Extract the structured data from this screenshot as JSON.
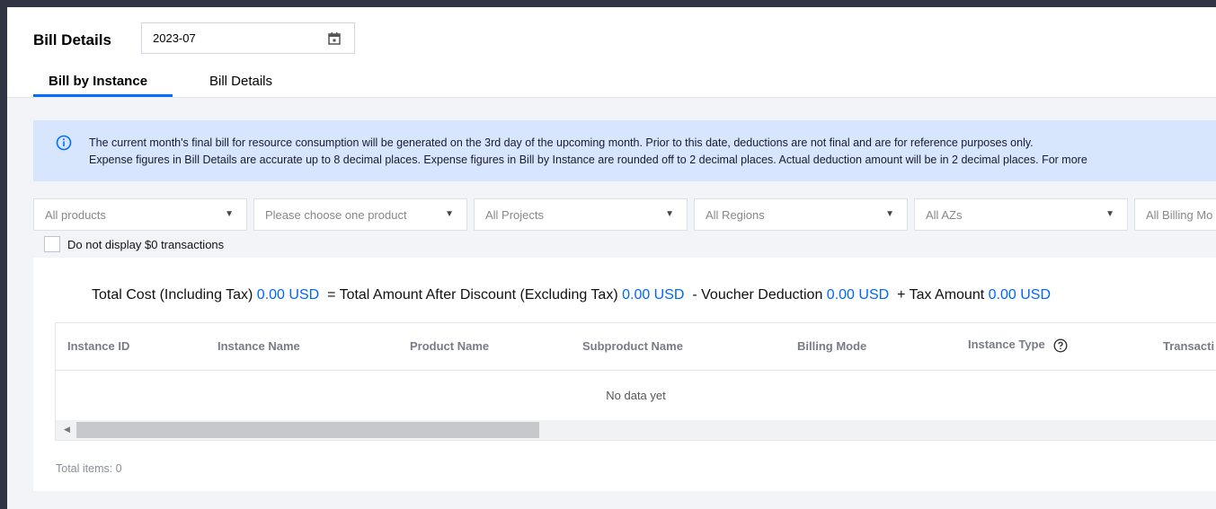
{
  "header": {
    "title": "Bill Details",
    "month": "2023-07"
  },
  "tabs": [
    {
      "label": "Bill by Instance",
      "active": true
    },
    {
      "label": "Bill Details",
      "active": false
    }
  ],
  "notice": {
    "line1": "The current month's final bill for resource consumption will be generated on the 3rd day of the upcoming month. Prior to this date, deductions are not final and are for reference purposes only.",
    "line2": "Expense figures in Bill Details are accurate up to 8 decimal places. Expense figures in Bill by Instance are rounded off to 2 decimal places. Actual deduction amount will be in 2 decimal places. For more"
  },
  "filters": {
    "products": "All products",
    "product_choice": "Please choose one product",
    "projects": "All Projects",
    "regions": "All Regions",
    "azs": "All AZs",
    "billing_modes": "All Billing Mo"
  },
  "hide_zero": {
    "label": "Do not display $0 transactions",
    "checked": false
  },
  "summary": {
    "total_cost_label": "Total Cost (Including Tax)",
    "total_cost": "0.00 USD",
    "after_discount_label": "= Total Amount After Discount (Excluding Tax)",
    "after_discount": "0.00 USD",
    "voucher_label": "- Voucher Deduction",
    "voucher": "0.00 USD",
    "tax_label": "+ Tax Amount",
    "tax": "0.00 USD"
  },
  "table": {
    "columns": [
      "Instance ID",
      "Instance Name",
      "Product Name",
      "Subproduct Name",
      "Billing Mode",
      "Instance Type",
      "Transacti"
    ],
    "empty_text": "No data yet",
    "scroll_fraction": 0.4
  },
  "footer": {
    "total_items": "Total items: 0"
  },
  "colors": {
    "accent": "#006eff",
    "amount": "#0066ff",
    "notice_bg": "#d7e6fd"
  }
}
